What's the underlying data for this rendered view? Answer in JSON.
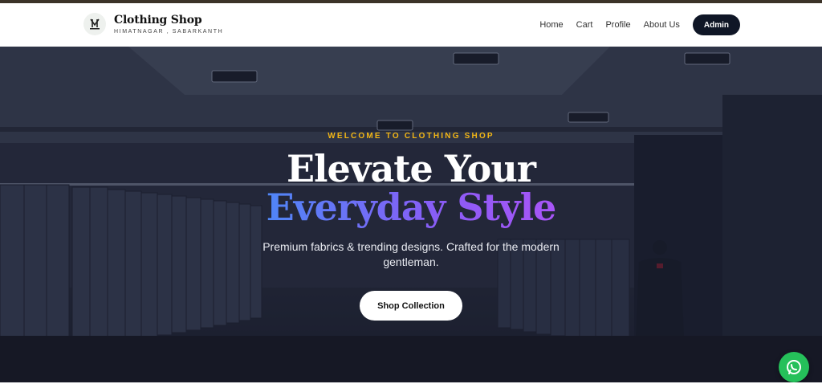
{
  "brand": {
    "title": "Clothing Shop",
    "subtitle": "HIMATNAGAR , SABARKANTH",
    "logo_icon": "suit-logo-icon"
  },
  "nav": {
    "links": [
      "Home",
      "Cart",
      "Profile",
      "About Us"
    ],
    "admin_label": "Admin"
  },
  "hero": {
    "eyebrow": "WELCOME TO CLOTHING SHOP",
    "headline_line1": "Elevate Your",
    "headline_line2": "Everyday Style",
    "tagline": "Premium fabrics & trending designs. Crafted for the modern gentleman.",
    "cta_label": "Shop Collection"
  },
  "floating": {
    "whatsapp_icon": "whatsapp-icon"
  },
  "colors": {
    "eyebrow": "#f2b615",
    "gradient_start": "#4f86f7",
    "gradient_end": "#a855f7",
    "admin_button": "#0f1626",
    "whatsapp": "#25c05a"
  }
}
